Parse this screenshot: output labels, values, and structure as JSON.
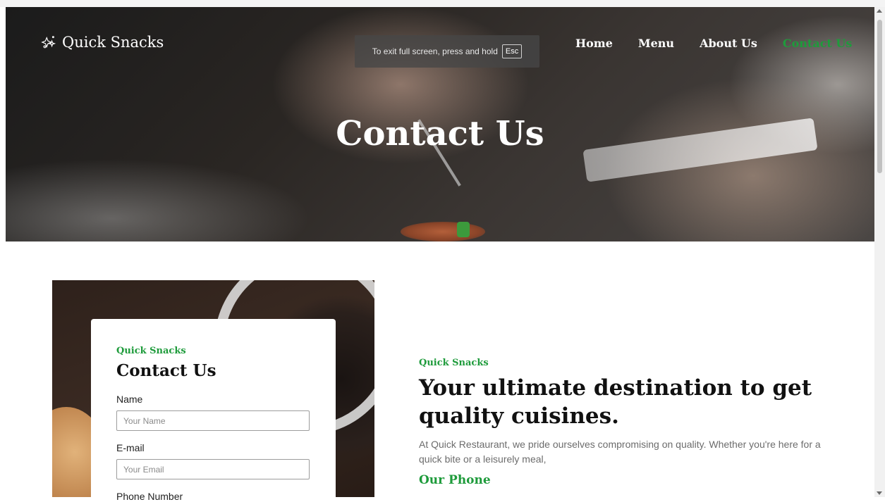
{
  "brand": {
    "name": "Quick Snacks",
    "icon": "sparkle-icon"
  },
  "nav": {
    "items": [
      {
        "label": "Home",
        "active": false
      },
      {
        "label": "Menu",
        "active": false
      },
      {
        "label": "About Us",
        "active": false
      },
      {
        "label": "Contact Us",
        "active": true
      }
    ]
  },
  "fullscreen_notice": {
    "text": "To exit full screen, press and hold",
    "key": "Esc"
  },
  "hero": {
    "title": "Contact Us"
  },
  "form": {
    "kicker": "Quick Snacks",
    "title": "Contact Us",
    "name_label": "Name",
    "name_placeholder": "Your Name",
    "email_label": "E-mail",
    "email_placeholder": "Your Email",
    "phone_label": "Phone Number"
  },
  "info": {
    "kicker": "Quick Snacks",
    "headline": "Your ultimate destination to get quality cuisines.",
    "description": "At Quick Restaurant, we pride ourselves compromising on quality. Whether you're here for a quick bite or a leisurely meal,",
    "phone_heading": "Our Phone"
  },
  "colors": {
    "accent": "#1e9b3b",
    "text_dark": "#111111",
    "muted": "#6c6c6c"
  }
}
